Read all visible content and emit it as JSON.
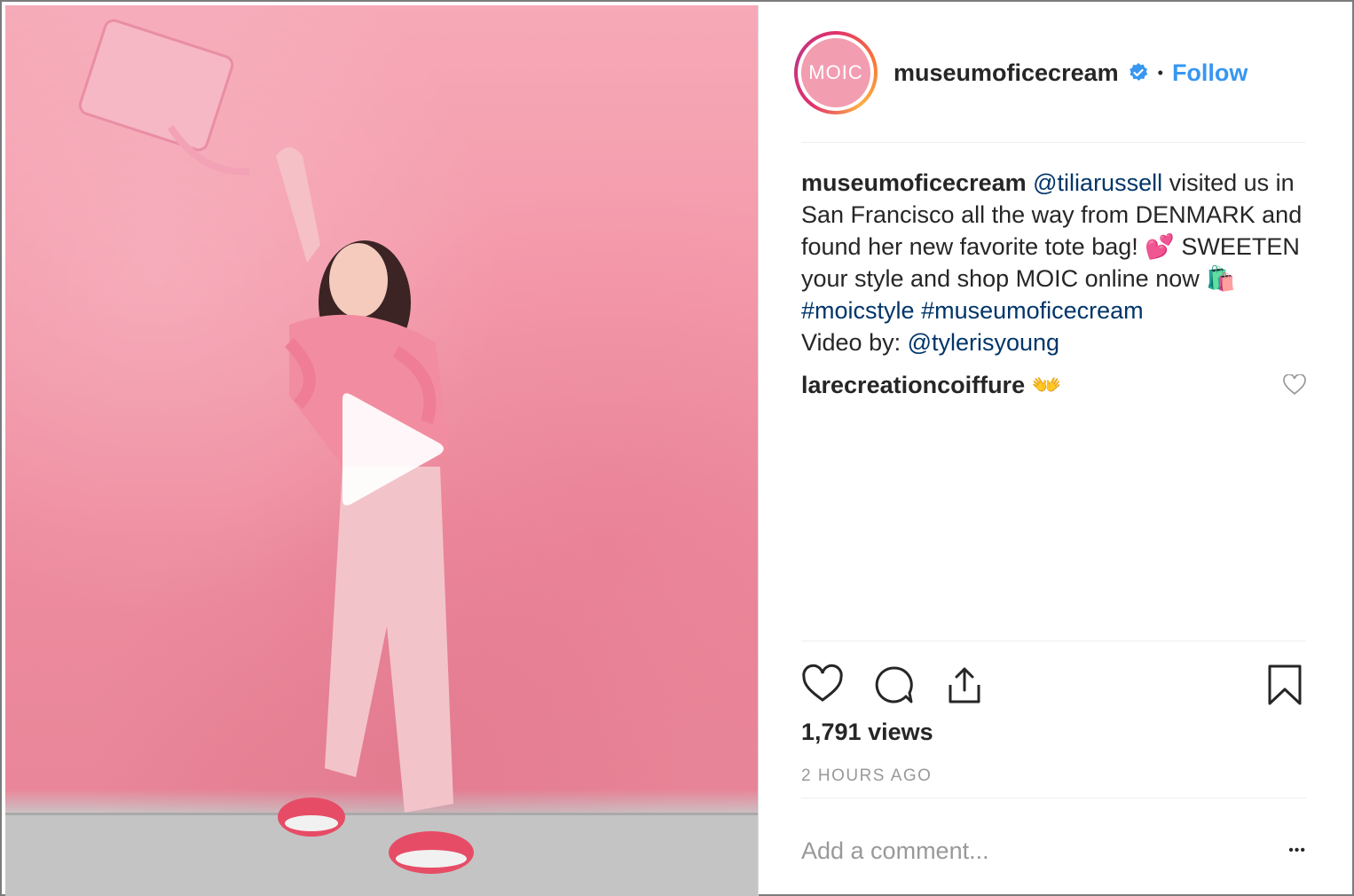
{
  "post": {
    "username": "museumoficecream",
    "avatar_text": "MOIC",
    "follow_label": "Follow",
    "separator": "•",
    "caption": {
      "author": "museumoficecream",
      "mention_1": "@tiliarussell",
      "text_1": " visited us in San Francisco all the way from DENMARK and found her new favorite tote bag! 💕 SWEETEN your style and shop MOIC online now 🛍️  ",
      "hashtag_1": "#moicstyle",
      "hashtag_2": "#museumoficecream",
      "text_2": "Video by: ",
      "mention_2": "@tylerisyoung"
    },
    "comment": {
      "author": "larecreationcoiffure",
      "text": "👐"
    },
    "views": "1,791 views",
    "timestamp": "2 HOURS AGO",
    "add_comment_placeholder": "Add a comment...",
    "more_label": "•••"
  },
  "colors": {
    "link": "#003569",
    "follow": "#3897f0",
    "wall": "#f49aab"
  },
  "icons": [
    "play-icon",
    "verified-badge-icon",
    "heart-icon",
    "comment-icon",
    "share-icon",
    "bookmark-icon",
    "like-comment-icon",
    "more-options-icon"
  ]
}
